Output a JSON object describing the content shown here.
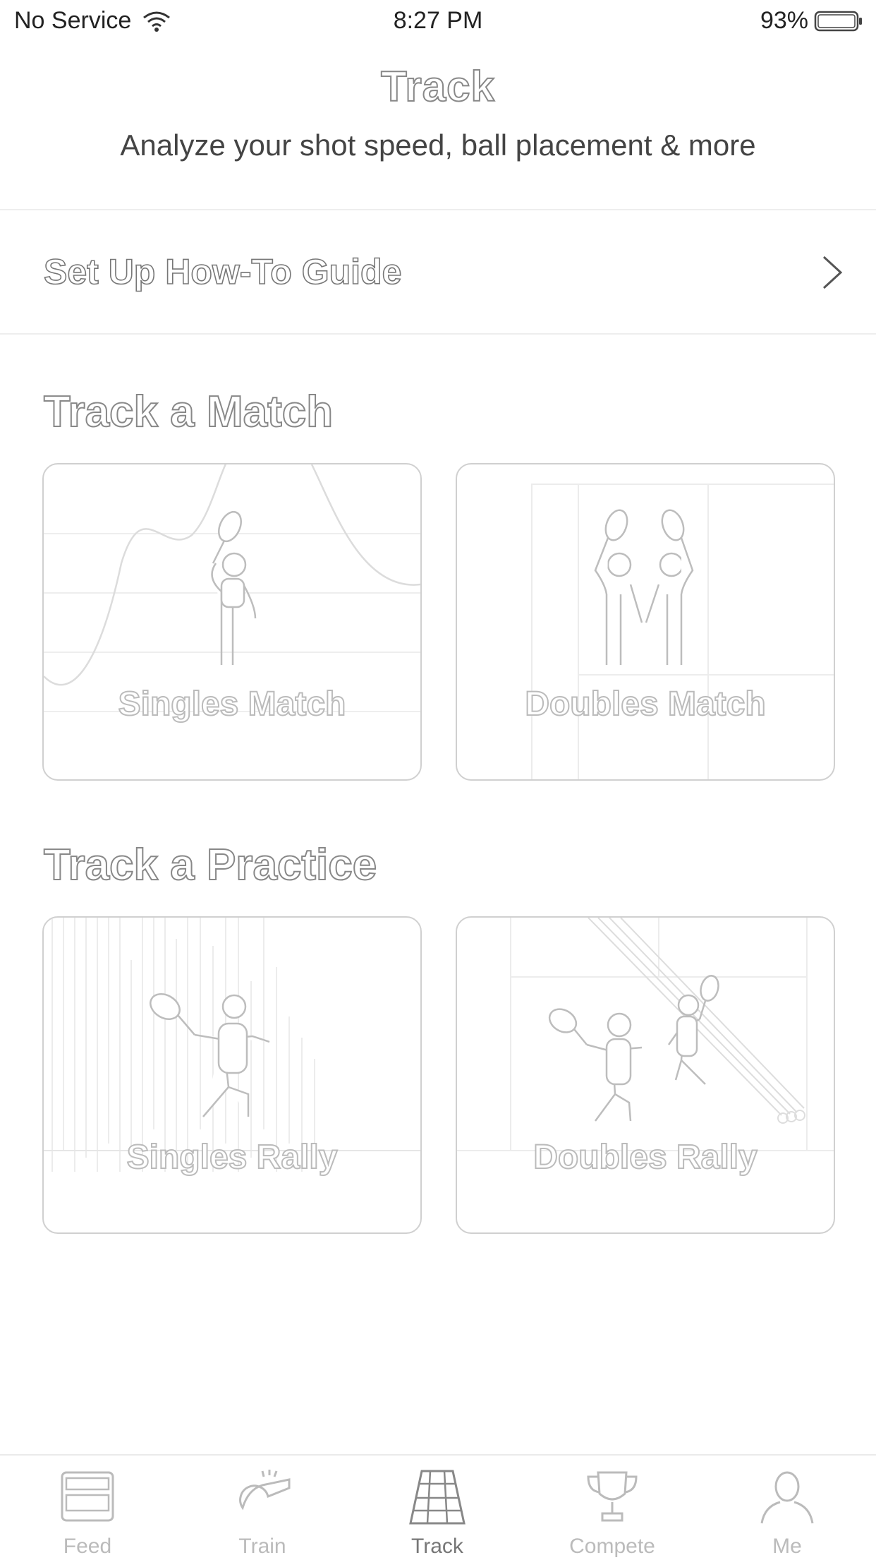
{
  "status_bar": {
    "carrier": "No Service",
    "time": "8:27 PM",
    "battery": "93%"
  },
  "header": {
    "title": "Track",
    "subtitle": "Analyze your shot speed, ball placement & more"
  },
  "guide": {
    "label": "Set Up How-To Guide"
  },
  "sections": {
    "match": {
      "title": "Track a Match",
      "cards": [
        {
          "label": "Singles Match"
        },
        {
          "label": "Doubles Match"
        }
      ]
    },
    "practice": {
      "title": "Track a Practice",
      "cards": [
        {
          "label": "Singles Rally"
        },
        {
          "label": "Doubles Rally"
        }
      ]
    }
  },
  "tabbar": {
    "items": [
      {
        "label": "Feed",
        "icon": "feed-icon"
      },
      {
        "label": "Train",
        "icon": "whistle-icon"
      },
      {
        "label": "Track",
        "icon": "court-icon",
        "active": true
      },
      {
        "label": "Compete",
        "icon": "trophy-icon"
      },
      {
        "label": "Me",
        "icon": "person-icon"
      }
    ]
  }
}
